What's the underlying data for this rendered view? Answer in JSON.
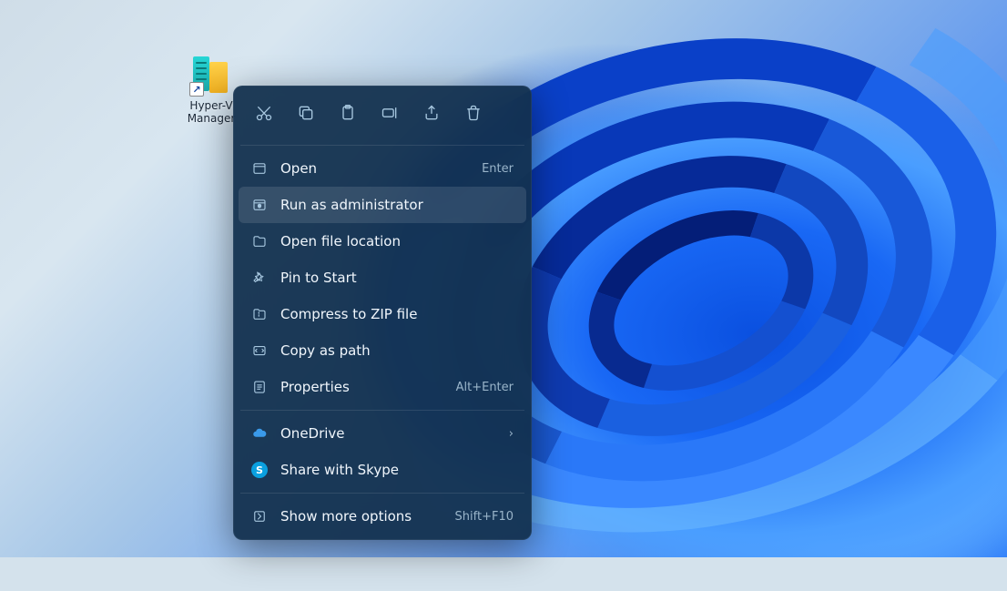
{
  "desktop": {
    "shortcut": {
      "label": "Hyper-V\nManager"
    }
  },
  "context_menu": {
    "quick_actions": [
      "cut",
      "copy",
      "paste",
      "rename",
      "share",
      "delete"
    ],
    "items": [
      {
        "icon": "window",
        "label": "Open",
        "shortcut": "Enter"
      },
      {
        "icon": "shield",
        "label": "Run as administrator",
        "highlight": true
      },
      {
        "icon": "folder",
        "label": "Open file location"
      },
      {
        "icon": "pin",
        "label": "Pin to Start"
      },
      {
        "icon": "zip",
        "label": "Compress to ZIP file"
      },
      {
        "icon": "path",
        "label": "Copy as path"
      },
      {
        "icon": "props",
        "label": "Properties",
        "shortcut": "Alt+Enter"
      }
    ],
    "extras": [
      {
        "icon": "onedrive",
        "label": "OneDrive",
        "chevron": true
      },
      {
        "icon": "skype",
        "label": "Share with Skype"
      }
    ],
    "more": {
      "icon": "more",
      "label": "Show more options",
      "shortcut": "Shift+F10"
    }
  }
}
